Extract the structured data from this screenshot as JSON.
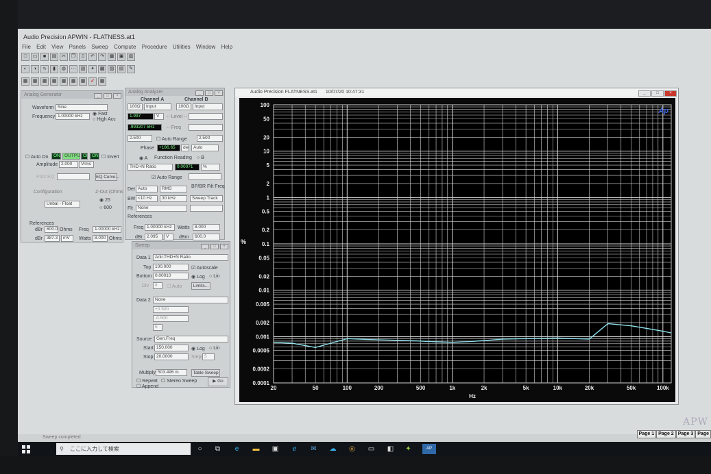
{
  "app": {
    "title": "Audio Precision APWIN - FLATNESS.at1",
    "menu": [
      "File",
      "Edit",
      "View",
      "Panels",
      "Sweep",
      "Compute",
      "Procedure",
      "Utilities",
      "Window",
      "Help"
    ],
    "status": "Sweep completed",
    "pages": [
      "Page 1",
      "Page 2",
      "Page 3",
      "Page"
    ],
    "watermark": "APW"
  },
  "generator": {
    "title": "Analog Generator",
    "waveform_label": "Waveform",
    "waveform": "Sine",
    "frequency_label": "Frequency",
    "frequency": "1.00000 kHz",
    "fast": "Fast",
    "high_acc": "High Acc",
    "auto_on": "Auto On",
    "on": "ON",
    "output": "OUTPUT",
    "invert": "Invert",
    "amplitude_label": "Amplitude",
    "amplitude": "2.000",
    "amplitude_unit": "Vrms",
    "post_eq": "Post EQ",
    "eq_curve": "EQ Curve...",
    "configuration": "Configuration",
    "config_value": "Unbal - Float",
    "zout": "Z-Out (Ohms",
    "z25": "25",
    "z600": "600",
    "references": "References",
    "dbr_label": "dBr",
    "dbr": "600.0",
    "ohms": "Ohms",
    "freq_label": "Freq",
    "freq": "1.00000 kHz",
    "dbv_label": "dBr",
    "dbv": "387.3",
    "dbv_unit": "mV",
    "watts_label": "Watts",
    "watts": "8.000",
    "watts_unit": "Ohms"
  },
  "analyzer": {
    "title": "Analog Analyzer",
    "channel_a": "Channel A",
    "channel_b": "Channel B",
    "range_a": "100Ω",
    "input_a": "Input",
    "range_b": "100Ω",
    "input_b": "Input",
    "level_a": "1.997",
    "level_unit": "V",
    "level_label": "-- Level --",
    "freq_a": ".993207 kHz",
    "freq_label": "-- Freq",
    "range_v": "2.500",
    "auto_range": "Auto Range",
    "range_v_b": "2.500",
    "phase_label": "Phase",
    "phase": "+186.65",
    "phase_unit": "deg",
    "phase_auto": "Auto",
    "function_reading": "Function Reading",
    "fa": "A",
    "fb": "B",
    "function": "THD+N Ratio",
    "reading": "0.00071",
    "reading_unit": "%",
    "auto_range2": "Auto Range",
    "det_label": "Det",
    "det": "Auto",
    "det_mode": "RMS",
    "bpbr": "BP/BR Filt Freq",
    "bw_label": "BW",
    "bw_low": "<10 Hz",
    "bw_high": "30 kHz",
    "bp": "Sweep Track",
    "fltr_label": "Flt",
    "fltr": "None",
    "references": "References",
    "ref_freq_label": "Freq",
    "ref_freq": "1.00000 kHz",
    "ref_watts_label": "Watts",
    "ref_watts": "8.000",
    "ref_dbr_label": "dBr",
    "ref_dbr": "2.095",
    "ref_dbr_unit": "V",
    "ref_dbm_label": "dBm",
    "ref_dbm": "600.0"
  },
  "sweep": {
    "title": "Sweep",
    "data1_label": "Data 1",
    "data1": "Anlr.THD+N Ratio",
    "top_label": "Top",
    "top": "100.000",
    "top_unit": "%",
    "autoscale": "Autoscale",
    "bottom_label": "Bottom",
    "bottom": "0.00010",
    "bottom_unit": "%",
    "log": "Log",
    "lin": "Lin",
    "div_label": "Div",
    "div": "8",
    "auto": "Auto",
    "limits": "Limits...",
    "data2_label": "Data 2",
    "data2": "None",
    "top2": "+0.500",
    "top2_unit": "dBr",
    "bottom2": "-0.500",
    "bottom2_unit": "dBr",
    "div2": "5",
    "source1_label": "Source 1",
    "source1": "Gen.Freq",
    "start_label": "Start",
    "start": "150.000",
    "start_unit": "kHz",
    "stop_label": "Stop",
    "stop": "20.0000",
    "stop_unit": "Hz",
    "steps_label": "Steps",
    "steps": "5",
    "multiply_label": "Multiply",
    "multiply": "503.496 m",
    "table_sweep": "Table Sweep",
    "repeat": "Repeat",
    "stereo": "Stereo Sweep",
    "append": "Append",
    "go": "Go"
  },
  "graph": {
    "title": "Audio Precision  FLATNESS.at1",
    "timestamp": "10/07/20 10:47:31",
    "logo": "Ap"
  },
  "chart_data": {
    "type": "line",
    "title": "",
    "xlabel": "Hz",
    "ylabel": "%",
    "xscale": "log",
    "yscale": "log",
    "xlim": [
      20,
      120000
    ],
    "ylim": [
      0.0001,
      100
    ],
    "grid": true,
    "xticks": [
      20,
      50,
      100,
      200,
      500,
      1000,
      2000,
      5000,
      10000,
      20000,
      50000,
      100000
    ],
    "xtick_labels": [
      "20",
      "50",
      "100",
      "200",
      "500",
      "1k",
      "2k",
      "5k",
      "10k",
      "20k",
      "50k",
      "100k"
    ],
    "yticks": [
      100,
      50,
      20,
      10,
      5,
      2,
      1,
      0.5,
      0.2,
      0.1,
      0.05,
      0.02,
      0.01,
      0.005,
      0.002,
      0.001,
      0.0005,
      0.0002,
      0.0001
    ],
    "ytick_labels": [
      "100",
      "50",
      "20",
      "10",
      "5",
      "2",
      "1",
      "0.5",
      "0.2",
      "0.1",
      "0.05",
      "0.02",
      "0.01",
      "0.005",
      "0.002",
      "0.001",
      "0.0005",
      "0.0002",
      "0.0001"
    ],
    "series": [
      {
        "color": "#8fe3ee",
        "x": [
          20,
          30,
          50,
          70,
          100,
          150,
          200,
          300,
          500,
          700,
          1000,
          1500,
          2000,
          3000,
          5000,
          7000,
          10000,
          15000,
          20000,
          30000,
          50000,
          70000,
          100000,
          120000
        ],
        "y": [
          0.00075,
          0.00072,
          0.00058,
          0.00072,
          0.0009,
          0.00087,
          0.00085,
          0.00083,
          0.0008,
          0.00077,
          0.00075,
          0.00078,
          0.00082,
          0.00088,
          0.0009,
          0.00092,
          0.00093,
          0.0009,
          0.00088,
          0.0019,
          0.0017,
          0.0015,
          0.0013,
          0.0012
        ]
      }
    ]
  },
  "taskbar": {
    "search_placeholder": "ここに入力して検索",
    "apps": [
      "task-view",
      "edge",
      "explorer",
      "store",
      "ie",
      "mail",
      "onedrive",
      "chrome",
      "app1",
      "app2",
      "app3",
      "apwin"
    ]
  }
}
